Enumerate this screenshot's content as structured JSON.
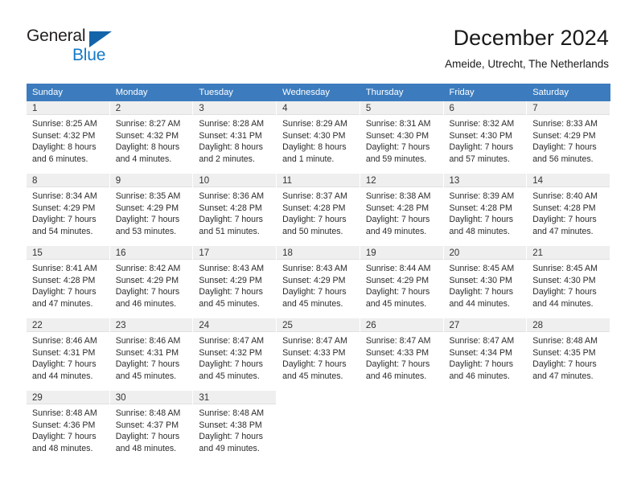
{
  "brand": {
    "name_part1": "General",
    "name_part2": "Blue",
    "triangle_color": "#1464aa",
    "blue_text_color": "#1479c8"
  },
  "header": {
    "title": "December 2024",
    "subtitle": "Ameide, Utrecht, The Netherlands"
  },
  "theme": {
    "header_row_bg": "#3c7cbe",
    "header_row_text": "#ffffff",
    "daynum_bg": "#efefef",
    "page_bg": "#ffffff"
  },
  "weekday_headers": [
    "Sunday",
    "Monday",
    "Tuesday",
    "Wednesday",
    "Thursday",
    "Friday",
    "Saturday"
  ],
  "weeks": [
    [
      {
        "day": "1",
        "sunrise": "Sunrise: 8:25 AM",
        "sunset": "Sunset: 4:32 PM",
        "daylight": "Daylight: 8 hours and 6 minutes."
      },
      {
        "day": "2",
        "sunrise": "Sunrise: 8:27 AM",
        "sunset": "Sunset: 4:32 PM",
        "daylight": "Daylight: 8 hours and 4 minutes."
      },
      {
        "day": "3",
        "sunrise": "Sunrise: 8:28 AM",
        "sunset": "Sunset: 4:31 PM",
        "daylight": "Daylight: 8 hours and 2 minutes."
      },
      {
        "day": "4",
        "sunrise": "Sunrise: 8:29 AM",
        "sunset": "Sunset: 4:30 PM",
        "daylight": "Daylight: 8 hours and 1 minute."
      },
      {
        "day": "5",
        "sunrise": "Sunrise: 8:31 AM",
        "sunset": "Sunset: 4:30 PM",
        "daylight": "Daylight: 7 hours and 59 minutes."
      },
      {
        "day": "6",
        "sunrise": "Sunrise: 8:32 AM",
        "sunset": "Sunset: 4:30 PM",
        "daylight": "Daylight: 7 hours and 57 minutes."
      },
      {
        "day": "7",
        "sunrise": "Sunrise: 8:33 AM",
        "sunset": "Sunset: 4:29 PM",
        "daylight": "Daylight: 7 hours and 56 minutes."
      }
    ],
    [
      {
        "day": "8",
        "sunrise": "Sunrise: 8:34 AM",
        "sunset": "Sunset: 4:29 PM",
        "daylight": "Daylight: 7 hours and 54 minutes."
      },
      {
        "day": "9",
        "sunrise": "Sunrise: 8:35 AM",
        "sunset": "Sunset: 4:29 PM",
        "daylight": "Daylight: 7 hours and 53 minutes."
      },
      {
        "day": "10",
        "sunrise": "Sunrise: 8:36 AM",
        "sunset": "Sunset: 4:28 PM",
        "daylight": "Daylight: 7 hours and 51 minutes."
      },
      {
        "day": "11",
        "sunrise": "Sunrise: 8:37 AM",
        "sunset": "Sunset: 4:28 PM",
        "daylight": "Daylight: 7 hours and 50 minutes."
      },
      {
        "day": "12",
        "sunrise": "Sunrise: 8:38 AM",
        "sunset": "Sunset: 4:28 PM",
        "daylight": "Daylight: 7 hours and 49 minutes."
      },
      {
        "day": "13",
        "sunrise": "Sunrise: 8:39 AM",
        "sunset": "Sunset: 4:28 PM",
        "daylight": "Daylight: 7 hours and 48 minutes."
      },
      {
        "day": "14",
        "sunrise": "Sunrise: 8:40 AM",
        "sunset": "Sunset: 4:28 PM",
        "daylight": "Daylight: 7 hours and 47 minutes."
      }
    ],
    [
      {
        "day": "15",
        "sunrise": "Sunrise: 8:41 AM",
        "sunset": "Sunset: 4:28 PM",
        "daylight": "Daylight: 7 hours and 47 minutes."
      },
      {
        "day": "16",
        "sunrise": "Sunrise: 8:42 AM",
        "sunset": "Sunset: 4:29 PM",
        "daylight": "Daylight: 7 hours and 46 minutes."
      },
      {
        "day": "17",
        "sunrise": "Sunrise: 8:43 AM",
        "sunset": "Sunset: 4:29 PM",
        "daylight": "Daylight: 7 hours and 45 minutes."
      },
      {
        "day": "18",
        "sunrise": "Sunrise: 8:43 AM",
        "sunset": "Sunset: 4:29 PM",
        "daylight": "Daylight: 7 hours and 45 minutes."
      },
      {
        "day": "19",
        "sunrise": "Sunrise: 8:44 AM",
        "sunset": "Sunset: 4:29 PM",
        "daylight": "Daylight: 7 hours and 45 minutes."
      },
      {
        "day": "20",
        "sunrise": "Sunrise: 8:45 AM",
        "sunset": "Sunset: 4:30 PM",
        "daylight": "Daylight: 7 hours and 44 minutes."
      },
      {
        "day": "21",
        "sunrise": "Sunrise: 8:45 AM",
        "sunset": "Sunset: 4:30 PM",
        "daylight": "Daylight: 7 hours and 44 minutes."
      }
    ],
    [
      {
        "day": "22",
        "sunrise": "Sunrise: 8:46 AM",
        "sunset": "Sunset: 4:31 PM",
        "daylight": "Daylight: 7 hours and 44 minutes."
      },
      {
        "day": "23",
        "sunrise": "Sunrise: 8:46 AM",
        "sunset": "Sunset: 4:31 PM",
        "daylight": "Daylight: 7 hours and 45 minutes."
      },
      {
        "day": "24",
        "sunrise": "Sunrise: 8:47 AM",
        "sunset": "Sunset: 4:32 PM",
        "daylight": "Daylight: 7 hours and 45 minutes."
      },
      {
        "day": "25",
        "sunrise": "Sunrise: 8:47 AM",
        "sunset": "Sunset: 4:33 PM",
        "daylight": "Daylight: 7 hours and 45 minutes."
      },
      {
        "day": "26",
        "sunrise": "Sunrise: 8:47 AM",
        "sunset": "Sunset: 4:33 PM",
        "daylight": "Daylight: 7 hours and 46 minutes."
      },
      {
        "day": "27",
        "sunrise": "Sunrise: 8:47 AM",
        "sunset": "Sunset: 4:34 PM",
        "daylight": "Daylight: 7 hours and 46 minutes."
      },
      {
        "day": "28",
        "sunrise": "Sunrise: 8:48 AM",
        "sunset": "Sunset: 4:35 PM",
        "daylight": "Daylight: 7 hours and 47 minutes."
      }
    ],
    [
      {
        "day": "29",
        "sunrise": "Sunrise: 8:48 AM",
        "sunset": "Sunset: 4:36 PM",
        "daylight": "Daylight: 7 hours and 48 minutes."
      },
      {
        "day": "30",
        "sunrise": "Sunrise: 8:48 AM",
        "sunset": "Sunset: 4:37 PM",
        "daylight": "Daylight: 7 hours and 48 minutes."
      },
      {
        "day": "31",
        "sunrise": "Sunrise: 8:48 AM",
        "sunset": "Sunset: 4:38 PM",
        "daylight": "Daylight: 7 hours and 49 minutes."
      },
      {
        "day": "",
        "sunrise": "",
        "sunset": "",
        "daylight": ""
      },
      {
        "day": "",
        "sunrise": "",
        "sunset": "",
        "daylight": ""
      },
      {
        "day": "",
        "sunrise": "",
        "sunset": "",
        "daylight": ""
      },
      {
        "day": "",
        "sunrise": "",
        "sunset": "",
        "daylight": ""
      }
    ]
  ]
}
